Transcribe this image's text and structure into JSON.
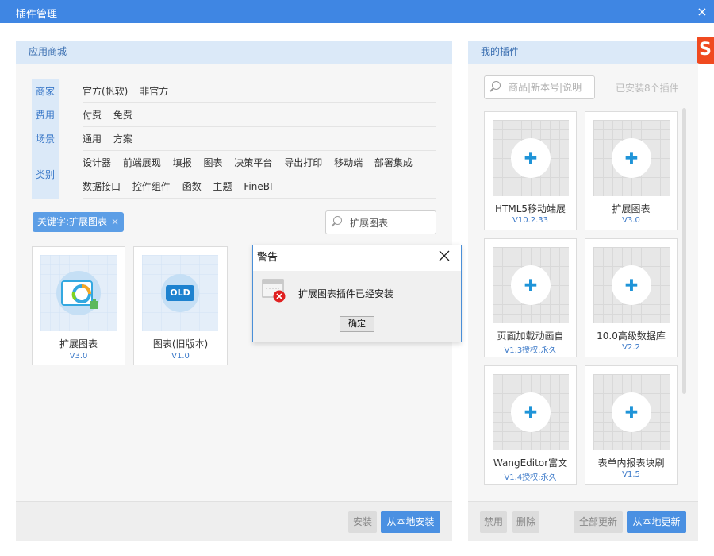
{
  "window": {
    "title": "插件管理",
    "close": "×"
  },
  "store": {
    "header": "应用商城",
    "filters": [
      {
        "category": "商家",
        "options": [
          "官方(帆软)",
          "非官方"
        ]
      },
      {
        "category": "费用",
        "options": [
          "付费",
          "免费"
        ]
      },
      {
        "category": "场景",
        "options": [
          "通用",
          "方案"
        ]
      },
      {
        "category": "类别",
        "options": [
          "设计器",
          "前端展现",
          "填报",
          "图表",
          "决策平台",
          "导出打印",
          "移动端",
          "部署集成",
          "数据接口",
          "控件组件",
          "函数",
          "主题",
          "FineBI"
        ]
      }
    ],
    "keyword_tag": "关键字:扩展图表",
    "keyword_tag_close": "×",
    "search_value": "扩展图表",
    "results": [
      {
        "name": "扩展图表",
        "version": "V3.0"
      },
      {
        "name": "图表(旧版本)",
        "version": "V1.0",
        "badge": "OLD"
      }
    ],
    "buttons": {
      "install": "安装",
      "install_local": "从本地安装"
    }
  },
  "mine": {
    "header": "我的插件",
    "search_placeholder": "商品|新本号|说明",
    "installed_count": "已安装8个插件",
    "plugins": [
      {
        "name": "HTML5移动端展",
        "version": "V10.2.33"
      },
      {
        "name": "扩展图表",
        "version": "V3.0"
      },
      {
        "name": "页面加载动画自",
        "version": "V1.3授权:永久"
      },
      {
        "name": "10.0高级数据库",
        "version": "V2.2"
      },
      {
        "name": "WangEditor富文",
        "version": "V1.4授权:永久"
      },
      {
        "name": "表单内报表块刷",
        "version": "V1.5"
      }
    ],
    "buttons": {
      "disable": "禁用",
      "delete": "删除",
      "update_all": "全部更新",
      "update_local": "从本地更新"
    }
  },
  "dialog": {
    "title": "警告",
    "message": "扩展图表插件已经安装",
    "ok": "确定",
    "close": "╳"
  },
  "logo_text": "S",
  "colors": {
    "titlebar": "#3f86e3",
    "accent": "#4a90e2",
    "panel_header": "#dbe9f8",
    "error": "#e02020"
  }
}
